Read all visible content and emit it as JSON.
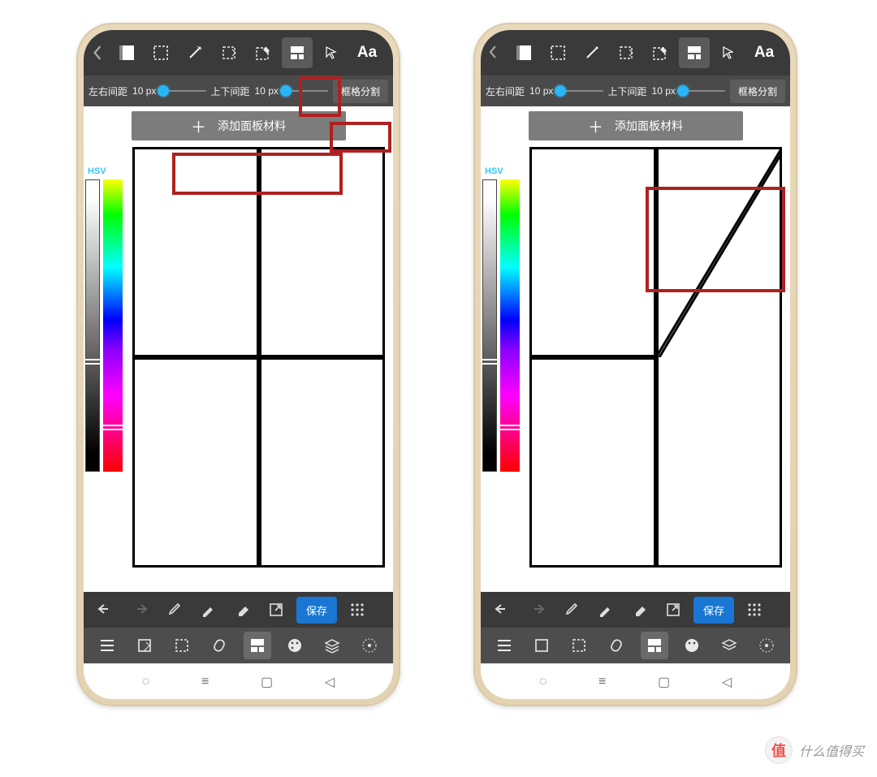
{
  "toolbar_top": {
    "text_aa": "Aa"
  },
  "sliders": {
    "left_label": "左右间距",
    "right_label": "上下间距",
    "value_px": "10 px",
    "split_button": "框格分割"
  },
  "add_panel": {
    "label": "添加面板材料"
  },
  "hsv_label": "HSV",
  "bottom_toolbar": {
    "save_label": "保存"
  },
  "watermark": {
    "badge": "值",
    "text": "什么值得买"
  }
}
